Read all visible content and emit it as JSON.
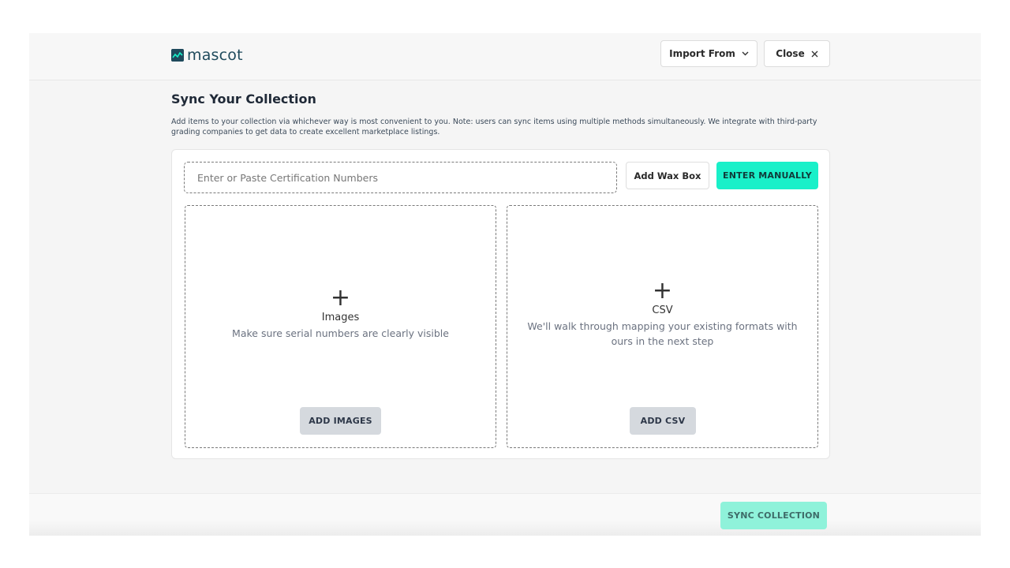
{
  "header": {
    "logo_text": "mascot",
    "import_label": "Import From",
    "close_label": "Close"
  },
  "page": {
    "title": "Sync Your Collection",
    "description": "Add items to your collection via whichever way is most convenient to you. Note: users can sync items using multiple methods simultaneously. We integrate with third-party grading companies to get data to create excellent marketplace listings."
  },
  "cert": {
    "placeholder": "Enter or Paste Certification Numbers",
    "value": ""
  },
  "actions": {
    "wax_box_label": "Add Wax Box",
    "enter_manually_label": "ENTER MANUALLY"
  },
  "images_zone": {
    "title": "Images",
    "subtitle": "Make sure serial numbers are clearly visible",
    "button_label": "ADD IMAGES"
  },
  "csv_zone": {
    "title": "CSV",
    "subtitle": "We'll walk through mapping your existing formats with ours in the next step",
    "button_label": "ADD CSV"
  },
  "footer": {
    "sync_label": "SYNC COLLECTION"
  },
  "colors": {
    "accent": "#19f0c9",
    "accent_disabled": "#8ff2da",
    "brand": "#1f4a5c"
  },
  "icons": {
    "logo": "chart-line-icon",
    "import_chevron": "chevron-down-icon",
    "close": "close-icon",
    "plus": "plus-icon"
  }
}
